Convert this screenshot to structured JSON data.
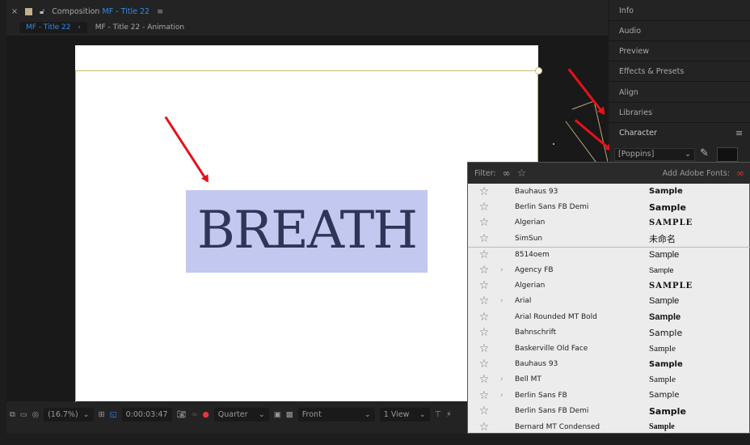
{
  "composition": {
    "close": "×",
    "title_prefix": "Composition",
    "title_name": "MF - Title 22",
    "menu": "≡",
    "tabs": [
      "MF - Title 22",
      "MF - Title 22 - Animation"
    ],
    "tab_chevron": "‹"
  },
  "canvas": {
    "text": "BREATH"
  },
  "toolbar": {
    "zoom": "(16.7%)",
    "timecode": "0:00:03:47",
    "resolution": "Quarter",
    "view": "Front",
    "layout": "1 View"
  },
  "panels": [
    "Info",
    "Audio",
    "Preview",
    "Effects & Presets",
    "Align",
    "Libraries"
  ],
  "character": {
    "title": "Character",
    "menu": "≡",
    "font": "[Poppins]"
  },
  "font_dropdown": {
    "filter_label": "Filter:",
    "add_label": "Add Adobe Fonts:",
    "fonts": [
      {
        "name": "Bauhaus 93",
        "sample": "Sample",
        "sub": false
      },
      {
        "name": "Berlin Sans FB Demi",
        "sample": "Sample",
        "sub": false
      },
      {
        "name": "Algerian",
        "sample": "SAMPLE",
        "sub": false
      },
      {
        "name": "SimSun",
        "sample": "未命名",
        "sub": false
      },
      {
        "name": "8514oem",
        "sample": "Sample",
        "sub": false
      },
      {
        "name": "Agency FB",
        "sample": "Sample",
        "sub": true
      },
      {
        "name": "Algerian",
        "sample": "SAMPLE",
        "sub": false
      },
      {
        "name": "Arial",
        "sample": "Sample",
        "sub": true
      },
      {
        "name": "Arial Rounded MT Bold",
        "sample": "Sample",
        "sub": false
      },
      {
        "name": "Bahnschrift",
        "sample": "Sample",
        "sub": false
      },
      {
        "name": "Baskerville Old Face",
        "sample": "Sample",
        "sub": false
      },
      {
        "name": "Bauhaus 93",
        "sample": "Sample",
        "sub": false
      },
      {
        "name": "Bell MT",
        "sample": "Sample",
        "sub": true
      },
      {
        "name": "Berlin Sans FB",
        "sample": "Sample",
        "sub": true
      },
      {
        "name": "Berlin Sans FB Demi",
        "sample": "Sample",
        "sub": false
      },
      {
        "name": "Bernard MT Condensed",
        "sample": "Sample",
        "sub": false
      }
    ]
  },
  "colors": {
    "accent": "#2d8ceb",
    "arrow": "#e8101a",
    "highlight": "#c2c8ef",
    "text": "#2f3557"
  }
}
